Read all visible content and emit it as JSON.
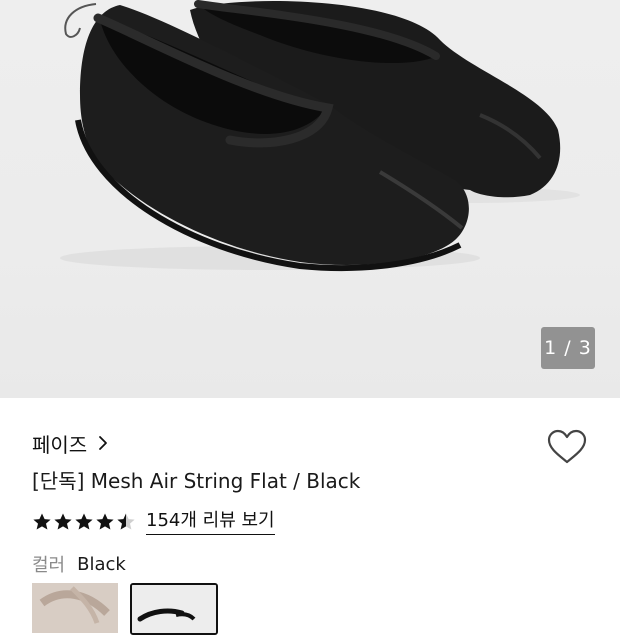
{
  "gallery": {
    "counter": "1 / 3",
    "image": "black-mesh-flat-shoes-photo"
  },
  "product": {
    "brand": "페이즈",
    "title": "[단독] Mesh Air String Flat / Black",
    "rating": 4.5,
    "review_link": "154개 리뷰 보기"
  },
  "options": {
    "color_label": "컬러",
    "color_value": "Black",
    "thumbnails": [
      "beige-mesh-flat-thumbnail",
      "black-mesh-flat-thumbnail"
    ],
    "selected_index": 1
  },
  "colors": {
    "star": "#111111",
    "text": "#111111",
    "muted": "#8a8a8a",
    "counter_bg": "#787878"
  },
  "icons": [
    "chevron-right-icon",
    "heart-outline-icon",
    "star-icon"
  ]
}
